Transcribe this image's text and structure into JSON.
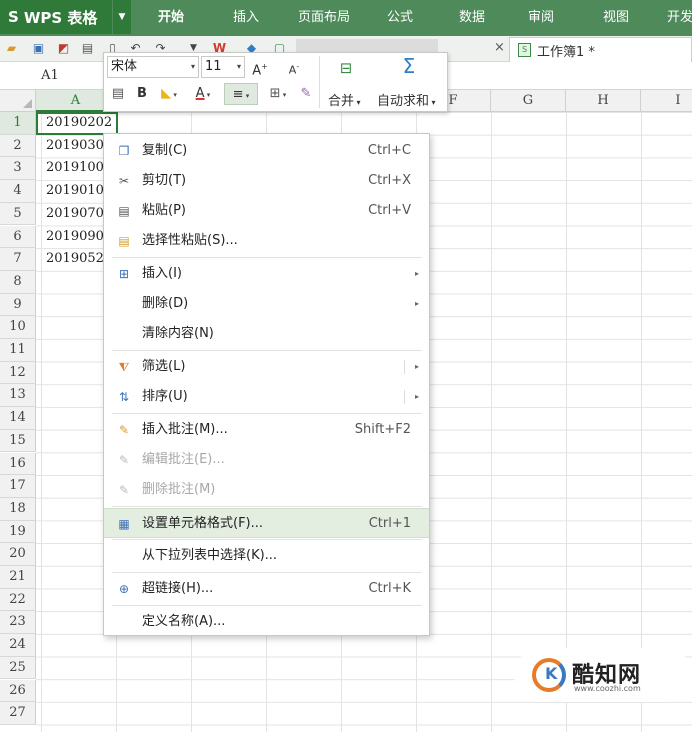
{
  "app": {
    "logo_text": "WPS 表格",
    "logo_mark": "S"
  },
  "ribbon": {
    "tabs": [
      {
        "label": "开始",
        "active": true
      },
      {
        "label": "插入",
        "active": false
      },
      {
        "label": "页面布局",
        "active": false
      },
      {
        "label": "公式",
        "active": false
      },
      {
        "label": "数据",
        "active": false
      },
      {
        "label": "审阅",
        "active": false
      },
      {
        "label": "视图",
        "active": false
      },
      {
        "label": "开发",
        "active": false
      }
    ]
  },
  "document": {
    "tab_name": "工作簿1 *",
    "close_glyph": "×"
  },
  "formula_bar": {
    "name_box": "A1"
  },
  "grid": {
    "columns": [
      "A",
      "B",
      "C",
      "D",
      "E",
      "F",
      "G",
      "H",
      "I"
    ],
    "rows": [
      "1",
      "2",
      "3",
      "4",
      "5",
      "6",
      "7",
      "8",
      "9",
      "10",
      "11",
      "12",
      "13",
      "14",
      "15",
      "16",
      "17",
      "18",
      "19",
      "20",
      "21",
      "22",
      "23",
      "24",
      "25",
      "26",
      "27"
    ],
    "cells_A": [
      "20190202",
      "2019030",
      "2019100",
      "2019010",
      "2019070",
      "2019090",
      "2019052"
    ]
  },
  "mini_toolbar": {
    "font_name": "宋体",
    "font_size": "11",
    "grow_font": "A",
    "shrink_font": "A",
    "bold": "B",
    "font_color_letter": "A",
    "merge_label": "合并",
    "autosum_label": "自动求和",
    "sum_glyph": "Σ",
    "dropdown_glyph": "▾"
  },
  "context_menu": {
    "items": [
      {
        "label": "复制(C)",
        "shortcut": "Ctrl+C",
        "icon": "copy-icon"
      },
      {
        "label": "剪切(T)",
        "shortcut": "Ctrl+X",
        "icon": "scissors-icon"
      },
      {
        "label": "粘贴(P)",
        "shortcut": "Ctrl+V",
        "icon": "paste-icon"
      },
      {
        "label": "选择性粘贴(S)...",
        "shortcut": "",
        "icon": "paste-special-icon"
      },
      {
        "label": "插入(I)",
        "shortcut": "",
        "icon": "insert-icon",
        "submenu": true
      },
      {
        "label": "删除(D)",
        "shortcut": "",
        "icon": "",
        "submenu": true
      },
      {
        "label": "清除内容(N)",
        "shortcut": "",
        "icon": ""
      },
      {
        "label": "筛选(L)",
        "shortcut": "",
        "icon": "filter-icon",
        "submenu": true
      },
      {
        "label": "排序(U)",
        "shortcut": "",
        "icon": "sort-icon",
        "submenu": true
      },
      {
        "label": "插入批注(M)...",
        "shortcut": "Shift+F2",
        "icon": "insert-comment-icon"
      },
      {
        "label": "编辑批注(E)...",
        "shortcut": "",
        "icon": "edit-comment-icon",
        "disabled": true
      },
      {
        "label": "删除批注(M)",
        "shortcut": "",
        "icon": "delete-comment-icon",
        "disabled": true
      },
      {
        "label": "设置单元格格式(F)...",
        "shortcut": "Ctrl+1",
        "icon": "format-cells-icon",
        "highlighted": true
      },
      {
        "label": "从下拉列表中选择(K)...",
        "shortcut": "",
        "icon": ""
      },
      {
        "label": "超链接(H)...",
        "shortcut": "Ctrl+K",
        "icon": "hyperlink-icon"
      },
      {
        "label": "定义名称(A)...",
        "shortcut": "",
        "icon": ""
      }
    ],
    "submenu_glyph": "▸"
  },
  "watermark": {
    "name": "酷知网",
    "url": "www.coozhi.com",
    "logo_letter": "K"
  },
  "colors": {
    "ribbon": "#4e8a5a",
    "logo_bg": "#2f7a39",
    "accent": "#2c7b36",
    "highlight": "#e3eee1"
  }
}
